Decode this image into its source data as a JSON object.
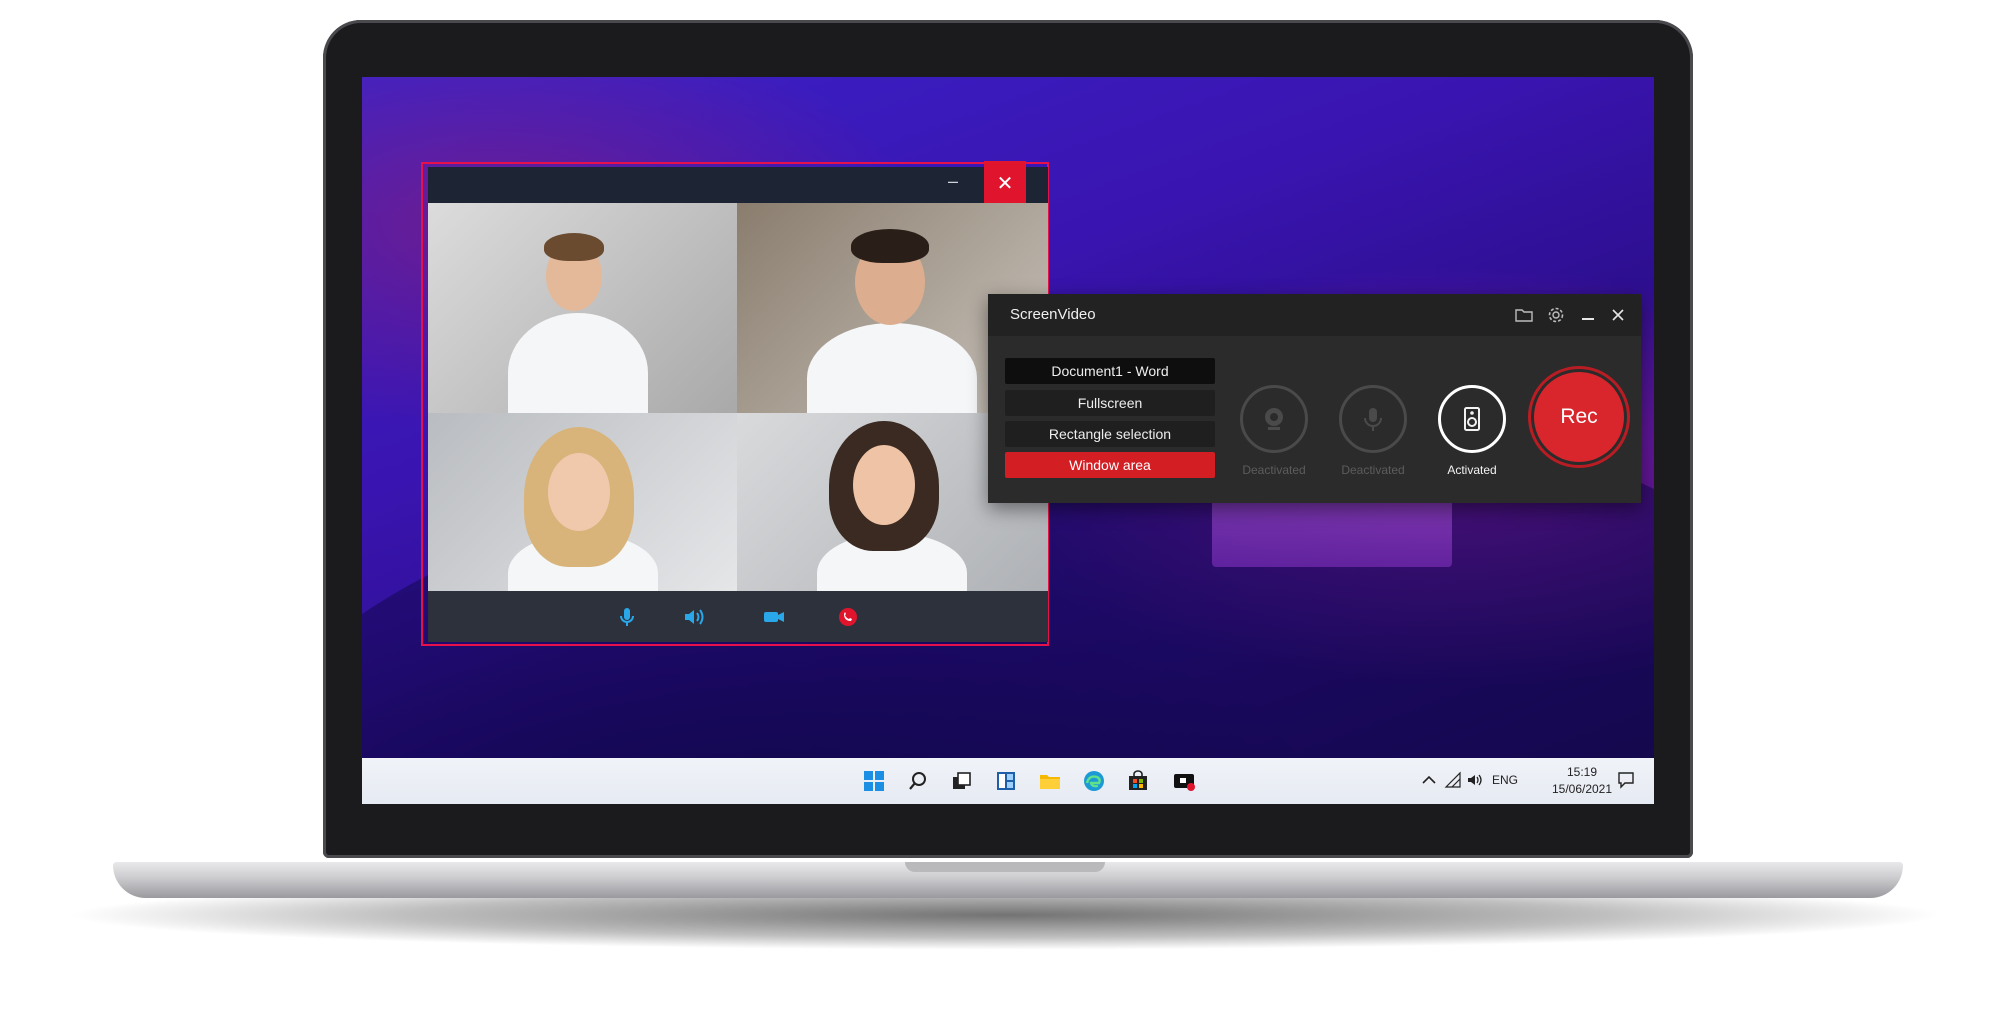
{
  "call_window": {
    "minimize_glyph": "–",
    "close_glyph": "✕"
  },
  "screenvideo": {
    "title": "ScreenVideo",
    "modes": [
      "Document1 - Word",
      "Fullscreen",
      "Rectangle selection",
      "Window area"
    ],
    "selected_mode": "Window area",
    "sources": [
      {
        "icon": "webcam-icon",
        "label": "Deactivated"
      },
      {
        "icon": "microphone-icon",
        "label": "Deactivated"
      },
      {
        "icon": "speaker-icon",
        "label": "Activated"
      }
    ],
    "rec_label": "Rec",
    "accent_color": "#d9262c"
  },
  "taskbar": {
    "language": "ENG",
    "time": "15:19",
    "date": "15/06/2021"
  }
}
